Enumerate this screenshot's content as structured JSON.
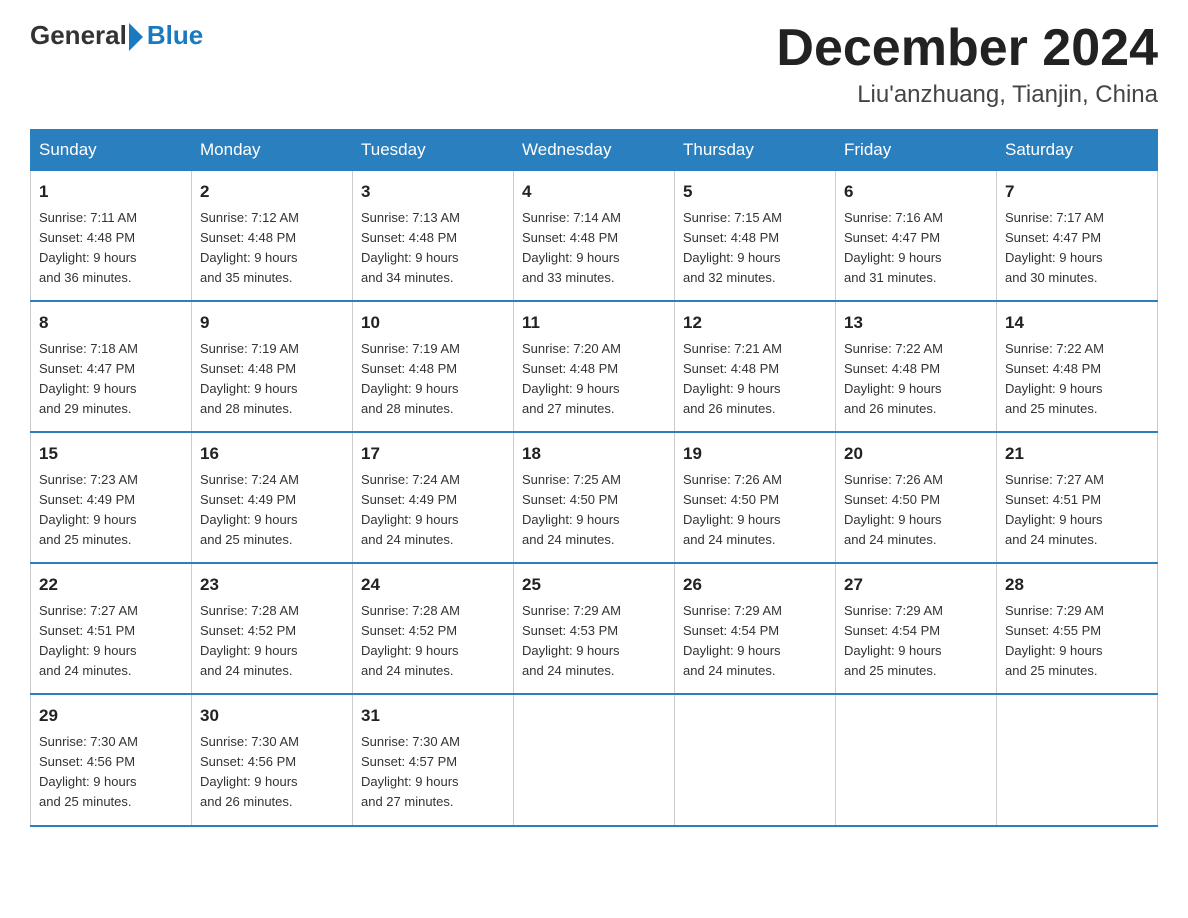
{
  "header": {
    "logo_general": "General",
    "logo_blue": "Blue",
    "month_title": "December 2024",
    "location": "Liu'anzhuang, Tianjin, China"
  },
  "days_of_week": [
    "Sunday",
    "Monday",
    "Tuesday",
    "Wednesday",
    "Thursday",
    "Friday",
    "Saturday"
  ],
  "weeks": [
    [
      {
        "day": "1",
        "sunrise": "7:11 AM",
        "sunset": "4:48 PM",
        "daylight": "9 hours and 36 minutes."
      },
      {
        "day": "2",
        "sunrise": "7:12 AM",
        "sunset": "4:48 PM",
        "daylight": "9 hours and 35 minutes."
      },
      {
        "day": "3",
        "sunrise": "7:13 AM",
        "sunset": "4:48 PM",
        "daylight": "9 hours and 34 minutes."
      },
      {
        "day": "4",
        "sunrise": "7:14 AM",
        "sunset": "4:48 PM",
        "daylight": "9 hours and 33 minutes."
      },
      {
        "day": "5",
        "sunrise": "7:15 AM",
        "sunset": "4:48 PM",
        "daylight": "9 hours and 32 minutes."
      },
      {
        "day": "6",
        "sunrise": "7:16 AM",
        "sunset": "4:47 PM",
        "daylight": "9 hours and 31 minutes."
      },
      {
        "day": "7",
        "sunrise": "7:17 AM",
        "sunset": "4:47 PM",
        "daylight": "9 hours and 30 minutes."
      }
    ],
    [
      {
        "day": "8",
        "sunrise": "7:18 AM",
        "sunset": "4:47 PM",
        "daylight": "9 hours and 29 minutes."
      },
      {
        "day": "9",
        "sunrise": "7:19 AM",
        "sunset": "4:48 PM",
        "daylight": "9 hours and 28 minutes."
      },
      {
        "day": "10",
        "sunrise": "7:19 AM",
        "sunset": "4:48 PM",
        "daylight": "9 hours and 28 minutes."
      },
      {
        "day": "11",
        "sunrise": "7:20 AM",
        "sunset": "4:48 PM",
        "daylight": "9 hours and 27 minutes."
      },
      {
        "day": "12",
        "sunrise": "7:21 AM",
        "sunset": "4:48 PM",
        "daylight": "9 hours and 26 minutes."
      },
      {
        "day": "13",
        "sunrise": "7:22 AM",
        "sunset": "4:48 PM",
        "daylight": "9 hours and 26 minutes."
      },
      {
        "day": "14",
        "sunrise": "7:22 AM",
        "sunset": "4:48 PM",
        "daylight": "9 hours and 25 minutes."
      }
    ],
    [
      {
        "day": "15",
        "sunrise": "7:23 AM",
        "sunset": "4:49 PM",
        "daylight": "9 hours and 25 minutes."
      },
      {
        "day": "16",
        "sunrise": "7:24 AM",
        "sunset": "4:49 PM",
        "daylight": "9 hours and 25 minutes."
      },
      {
        "day": "17",
        "sunrise": "7:24 AM",
        "sunset": "4:49 PM",
        "daylight": "9 hours and 24 minutes."
      },
      {
        "day": "18",
        "sunrise": "7:25 AM",
        "sunset": "4:50 PM",
        "daylight": "9 hours and 24 minutes."
      },
      {
        "day": "19",
        "sunrise": "7:26 AM",
        "sunset": "4:50 PM",
        "daylight": "9 hours and 24 minutes."
      },
      {
        "day": "20",
        "sunrise": "7:26 AM",
        "sunset": "4:50 PM",
        "daylight": "9 hours and 24 minutes."
      },
      {
        "day": "21",
        "sunrise": "7:27 AM",
        "sunset": "4:51 PM",
        "daylight": "9 hours and 24 minutes."
      }
    ],
    [
      {
        "day": "22",
        "sunrise": "7:27 AM",
        "sunset": "4:51 PM",
        "daylight": "9 hours and 24 minutes."
      },
      {
        "day": "23",
        "sunrise": "7:28 AM",
        "sunset": "4:52 PM",
        "daylight": "9 hours and 24 minutes."
      },
      {
        "day": "24",
        "sunrise": "7:28 AM",
        "sunset": "4:52 PM",
        "daylight": "9 hours and 24 minutes."
      },
      {
        "day": "25",
        "sunrise": "7:29 AM",
        "sunset": "4:53 PM",
        "daylight": "9 hours and 24 minutes."
      },
      {
        "day": "26",
        "sunrise": "7:29 AM",
        "sunset": "4:54 PM",
        "daylight": "9 hours and 24 minutes."
      },
      {
        "day": "27",
        "sunrise": "7:29 AM",
        "sunset": "4:54 PM",
        "daylight": "9 hours and 25 minutes."
      },
      {
        "day": "28",
        "sunrise": "7:29 AM",
        "sunset": "4:55 PM",
        "daylight": "9 hours and 25 minutes."
      }
    ],
    [
      {
        "day": "29",
        "sunrise": "7:30 AM",
        "sunset": "4:56 PM",
        "daylight": "9 hours and 25 minutes."
      },
      {
        "day": "30",
        "sunrise": "7:30 AM",
        "sunset": "4:56 PM",
        "daylight": "9 hours and 26 minutes."
      },
      {
        "day": "31",
        "sunrise": "7:30 AM",
        "sunset": "4:57 PM",
        "daylight": "9 hours and 27 minutes."
      },
      null,
      null,
      null,
      null
    ]
  ],
  "labels": {
    "sunrise": "Sunrise:",
    "sunset": "Sunset:",
    "daylight": "Daylight:"
  }
}
